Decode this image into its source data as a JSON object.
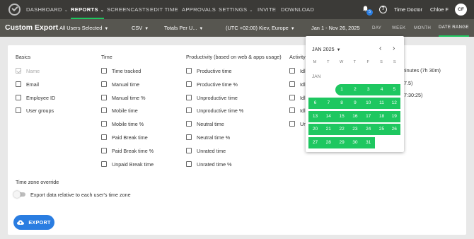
{
  "nav": {
    "items": [
      {
        "label": "DASHBOARD",
        "caret": true
      },
      {
        "label": "REPORTS",
        "caret": true,
        "active": true
      },
      {
        "label": "SCREENCASTS"
      },
      {
        "label": "EDIT TIME"
      },
      {
        "label": "APPROVALS"
      },
      {
        "label": "SETTINGS",
        "caret": true
      },
      {
        "label": "INVITE"
      },
      {
        "label": "DOWNLOAD"
      }
    ],
    "notification_count": "5",
    "help_symbol": "?",
    "org_name": "Time Doctor",
    "user_name": "Chloe F",
    "avatar_initials": "CF"
  },
  "subbar": {
    "title": "Custom Export",
    "users_filter": "All Users Selected",
    "format": "CSV",
    "totals": "Totals Per U...",
    "timezone": "(UTC +02:00) Kiev, Europe",
    "date_range": "Jan 1 - Nov 26, 2025",
    "range_tabs": [
      "DAY",
      "WEEK",
      "MONTH",
      "DATE RANGE"
    ],
    "active_range_tab": "DATE RANGE"
  },
  "sections": {
    "basics": {
      "title": "Basics",
      "options": [
        {
          "label": "Name",
          "checked": true,
          "disabled": true
        },
        {
          "label": "Email",
          "checked": false
        },
        {
          "label": "Employee ID",
          "checked": false
        },
        {
          "label": "User groups",
          "checked": false
        }
      ]
    },
    "time": {
      "title": "Time",
      "options": [
        {
          "label": "Time tracked"
        },
        {
          "label": "Manual time"
        },
        {
          "label": "Manual time %"
        },
        {
          "label": "Mobile time"
        },
        {
          "label": "Mobile time %"
        },
        {
          "label": "Paid Break time"
        },
        {
          "label": "Paid Break time %"
        },
        {
          "label": "Unpaid Break time"
        }
      ]
    },
    "productivity": {
      "title": "Productivity (based on web & apps usage)",
      "options": [
        {
          "label": "Productive time"
        },
        {
          "label": "Productive time %"
        },
        {
          "label": "Unproductive time"
        },
        {
          "label": "Unproductive time %"
        },
        {
          "label": "Neutral time"
        },
        {
          "label": "Neutral time %"
        },
        {
          "label": "Unrated time"
        },
        {
          "label": "Unrated time %"
        }
      ]
    },
    "activity": {
      "title": "Activity",
      "options": [
        {
          "label": "Idle"
        },
        {
          "label": "Idle"
        },
        {
          "label": "Idle"
        },
        {
          "label": "Idle"
        },
        {
          "label": "Unu"
        }
      ],
      "partial_texts": [
        "minutes (7h 30m)",
        "7.5)",
        "7:30:25)"
      ]
    }
  },
  "timezone_override": {
    "title": "Time zone override",
    "toggle_label": "Export data relative to each user's time zone",
    "enabled": false
  },
  "export_button": {
    "label": "EXPORT",
    "icon": "cloud-upload-icon"
  },
  "calendar": {
    "month_label": "JAN 2025",
    "prev_symbol": "‹",
    "next_symbol": "›",
    "weekdays": [
      "M",
      "T",
      "W",
      "T",
      "F",
      "S",
      "S"
    ],
    "section_label": "JAN",
    "first_weekday_index": 2,
    "days_in_month": 31,
    "selected_from": 1,
    "selected_to": 31
  },
  "colors": {
    "accent_green": "#1ec760",
    "primary_blue": "#2a7de1",
    "nav_bg": "#3b3a37",
    "subbar_bg": "#575650"
  }
}
